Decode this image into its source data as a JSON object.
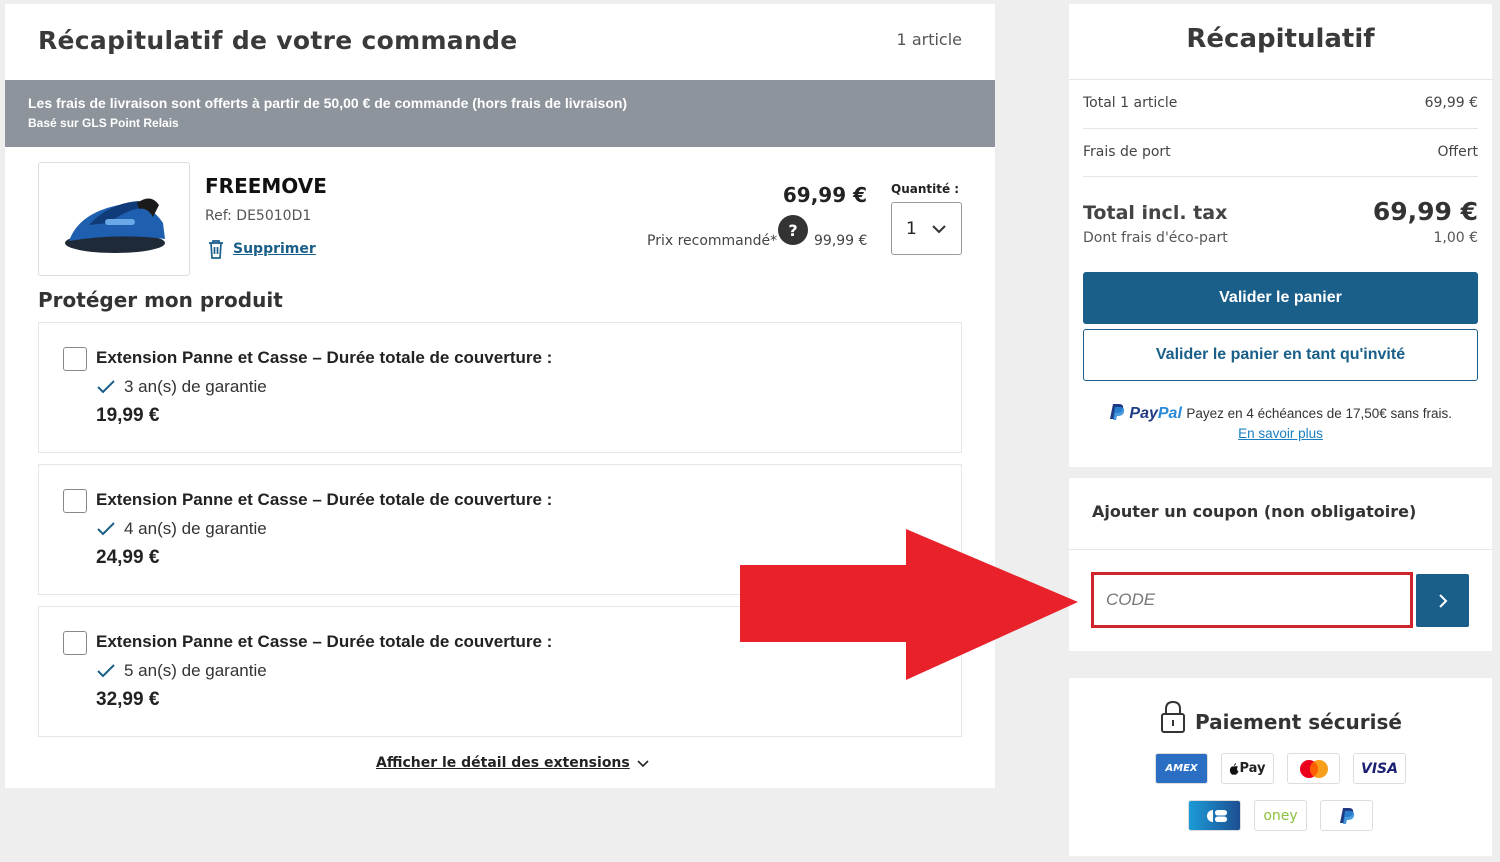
{
  "order": {
    "title": "Récapitulatif de votre commande",
    "article_count": "1 article",
    "shipping_banner": {
      "line1": "Les frais de livraison sont offerts à partir de 50,00 € de commande (hors frais de livraison)",
      "line2": "Basé sur GLS Point Relais"
    },
    "product": {
      "name": "FREEMOVE",
      "ref": "Ref: DE5010D1",
      "delete_label": "Supprimer",
      "price": "69,99 €",
      "recommended_label": "Prix recommandé*",
      "help_symbol": "?",
      "recommended_price": "99,99 €",
      "quantity_label": "Quantité :",
      "quantity": "1"
    },
    "protect_title": "Protéger mon produit",
    "extensions": [
      {
        "title": "Extension Panne et Casse – Durée totale de couverture :",
        "duration": "3 an(s) de garantie",
        "price": "19,99 €"
      },
      {
        "title": "Extension Panne et Casse – Durée totale de couverture :",
        "duration": "4 an(s) de garantie",
        "price": "24,99 €"
      },
      {
        "title": "Extension Panne et Casse – Durée totale de couverture :",
        "duration": "5 an(s) de garantie",
        "price": "32,99 €"
      }
    ],
    "details_link": "Afficher le détail des extensions"
  },
  "summary": {
    "title": "Récapitulatif",
    "rows": [
      {
        "label": "Total 1 article",
        "value": "69,99 €"
      },
      {
        "label": "Frais de port",
        "value": "Offert"
      }
    ],
    "total_label": "Total incl. tax",
    "total_value": "69,99 €",
    "eco_label": "Dont frais d'éco-part",
    "eco_value": "1,00 €",
    "validate_button": "Valider le panier",
    "guest_button": "Valider le panier en tant qu'invité",
    "paypal": {
      "logo_pay": "Pay",
      "logo_pal": "Pal",
      "text": "Payez en 4 échéances de 17,50€ sans frais.",
      "link": "En savoir plus"
    }
  },
  "coupon": {
    "title": "Ajouter un coupon (non obligatoire)",
    "placeholder": "CODE"
  },
  "secure": {
    "title": "Paiement sécurisé",
    "cards_row1": [
      "AMEX",
      "Pay",
      "",
      "VISA"
    ],
    "cards_row2": [
      "",
      "oney",
      ""
    ]
  },
  "colors": {
    "primary": "#1a5f8a",
    "banner": "#8e949c",
    "coupon_border": "#d1232a",
    "arrow": "#e8212a"
  }
}
